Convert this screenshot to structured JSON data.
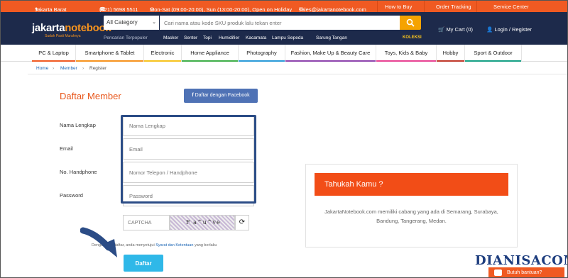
{
  "topbar": {
    "location": "Jakarta Barat",
    "phone": "(021) 5698 5511",
    "hours": "Mon-Sat (09:00-20:00), Sun (13:00-20:00), Open on Holiday",
    "email": "sales@jakartanotebook.com",
    "links": [
      "How to Buy",
      "Order Tracking",
      "Service Center"
    ]
  },
  "header": {
    "logo_main": "jakarta",
    "logo_accent": "notebook",
    "logo_tagline": "Sudah Pasti Murahnya",
    "category_select": "All Category",
    "search_placeholder": "Cari nama atau kode SKU produk lalu tekan enter",
    "popular_label": "Pencarian Terpopuler",
    "popular": [
      "Masker",
      "Senter",
      "Topi",
      "Humidifier",
      "Kacamata",
      "Lampu Sepeda",
      "Sarung Tangan"
    ],
    "koleksi": "KOLEKSI",
    "cart_label": "My Cart",
    "cart_count": "(0)",
    "login_label": "Login / Register"
  },
  "nav": {
    "items": [
      {
        "label": "PC & Laptop",
        "color": "#f05a22"
      },
      {
        "label": "Smartphone & Tablet",
        "color": "#f7931e"
      },
      {
        "label": "Electronic",
        "color": "#f7c31e"
      },
      {
        "label": "Home Appliance",
        "color": "#3fae49"
      },
      {
        "label": "Photography",
        "color": "#2b9bd8"
      },
      {
        "label": "Fashion, Make Up & Beauty Care",
        "color": "#8e44ad"
      },
      {
        "label": "Toys, Kids & Baby",
        "color": "#e84393"
      },
      {
        "label": "Hobby",
        "color": "#c0392b"
      },
      {
        "label": "Sport & Outdoor",
        "color": "#16a085"
      }
    ]
  },
  "breadcrumb": [
    "Home",
    "Member",
    "Register"
  ],
  "form": {
    "title": "Daftar Member",
    "facebook_button": "Daftar dengan Facebook",
    "fields": [
      {
        "label": "Nama Lengkap",
        "placeholder": "Nama Lengkap"
      },
      {
        "label": "Email",
        "placeholder": "Email"
      },
      {
        "label": "No. Handphone",
        "placeholder": "Nomor Telepon / Handphone"
      },
      {
        "label": "Password",
        "placeholder": "Password"
      }
    ],
    "captcha_placeholder": "CAPTCHA",
    "captcha_text": "F a^u^ve",
    "terms_prefix": "Dengan mendaftar, anda menyetujui",
    "terms_link": "Syarat dan Ketentuan",
    "terms_suffix": "yang berlaku",
    "submit": "Daftar"
  },
  "info": {
    "title": "Tahukah Kamu ?",
    "text": "JakartaNotebook.com memiliki cabang yang ada di Semarang, Surabaya, Bandung, Tangerang, Medan."
  },
  "watermark": "DIANISACOM",
  "chat": {
    "label": "Butuh bantuan?"
  }
}
